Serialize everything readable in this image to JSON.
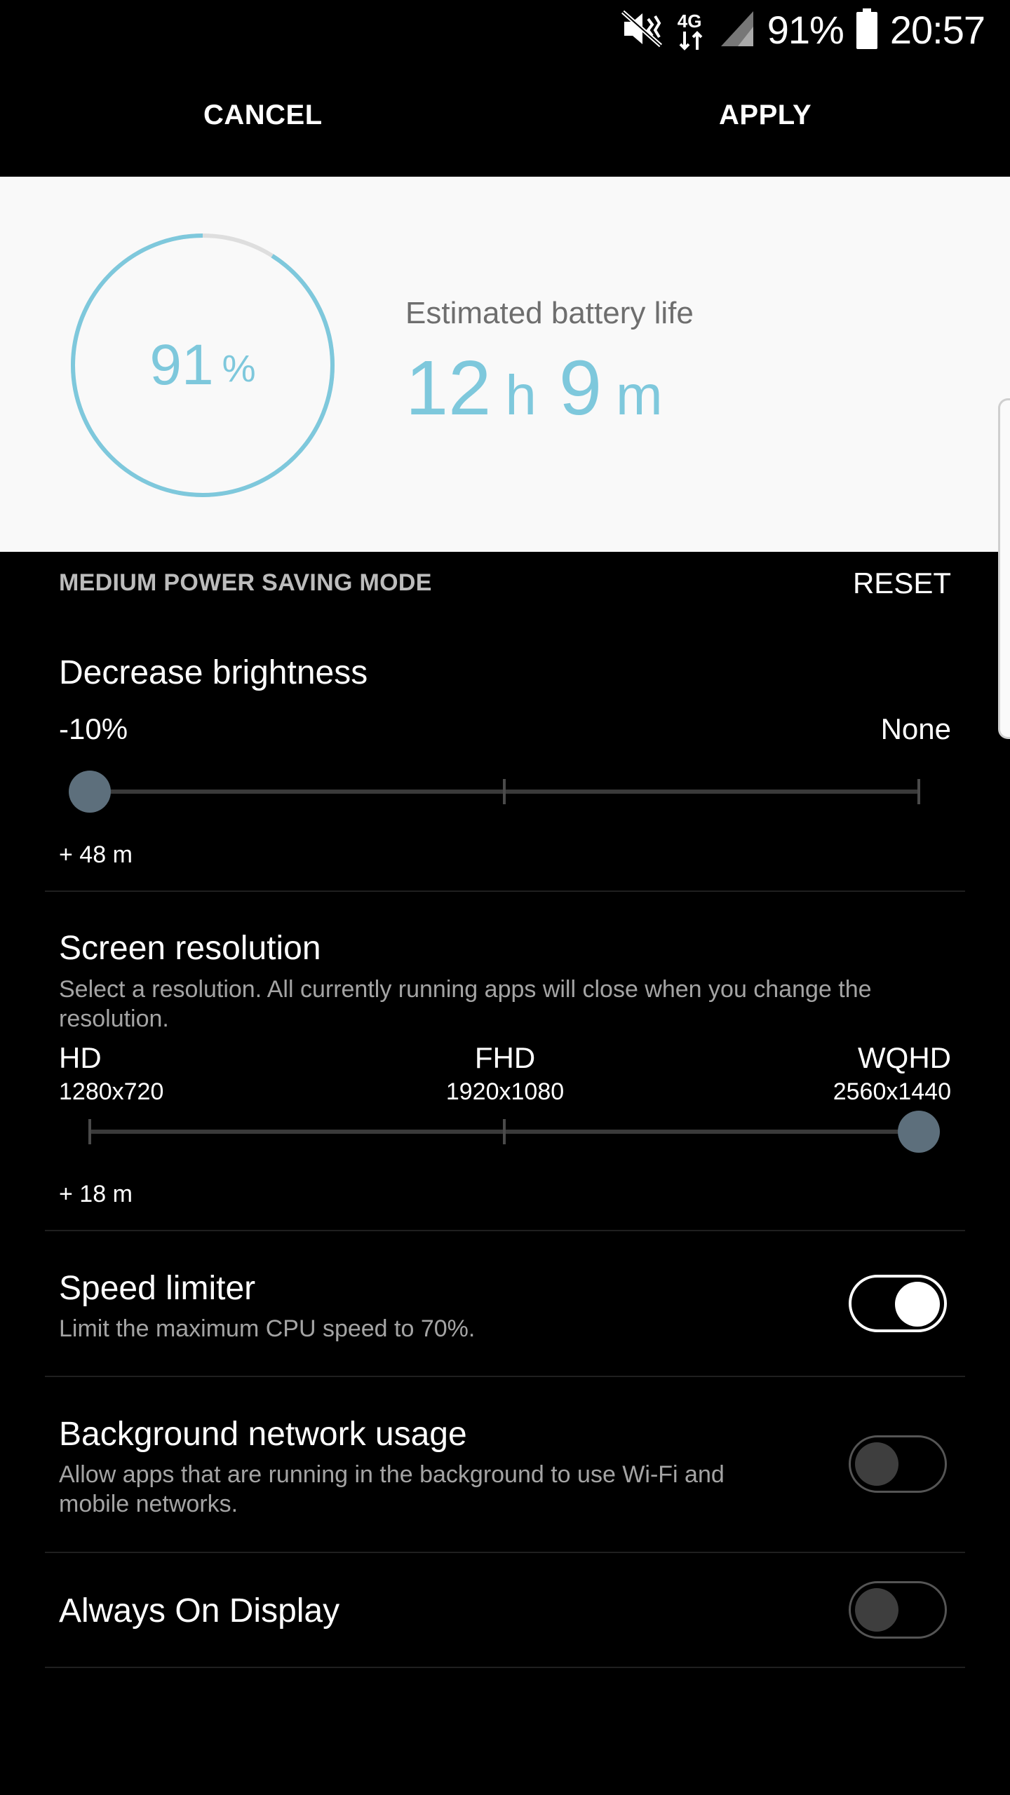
{
  "status_bar": {
    "network": "4G",
    "battery_percent": "91%",
    "time": "20:57"
  },
  "actions": {
    "cancel": "CANCEL",
    "apply": "APPLY"
  },
  "battery": {
    "percent_value": "91",
    "percent_unit": "%",
    "level": 0.91,
    "estimate_label": "Estimated battery life",
    "estimate_hours": "12",
    "hours_unit": "h",
    "estimate_minutes": "9",
    "minutes_unit": "m"
  },
  "mode": {
    "title": "MEDIUM POWER SAVING MODE",
    "reset": "RESET"
  },
  "brightness": {
    "title": "Decrease brightness",
    "left_label": "-10%",
    "right_label": "None",
    "gain": "+ 48 m",
    "selected_index": 0
  },
  "resolution": {
    "title": "Screen resolution",
    "description": "Select a resolution. All currently running apps will close when you change the resolution.",
    "options": [
      {
        "name": "HD",
        "size": "1280x720"
      },
      {
        "name": "FHD",
        "size": "1920x1080"
      },
      {
        "name": "WQHD",
        "size": "2560x1440"
      }
    ],
    "selected_index": 2,
    "gain": "+ 18 m"
  },
  "speed_limiter": {
    "title": "Speed limiter",
    "description": "Limit the maximum CPU speed to 70%.",
    "enabled": true
  },
  "background_network": {
    "title": "Background network usage",
    "description": "Allow apps that are running in the background to use Wi-Fi and mobile networks.",
    "enabled": false
  },
  "always_on_display": {
    "title": "Always On Display",
    "enabled": false
  },
  "colors": {
    "accent": "#7ec8dc",
    "panel_bg": "#f9f9f9",
    "thumb": "#5d6f7c"
  },
  "icons": {
    "mute": "mute-vibrate-icon",
    "network": "network-4g-icon",
    "signal": "signal-icon",
    "battery": "battery-icon"
  }
}
